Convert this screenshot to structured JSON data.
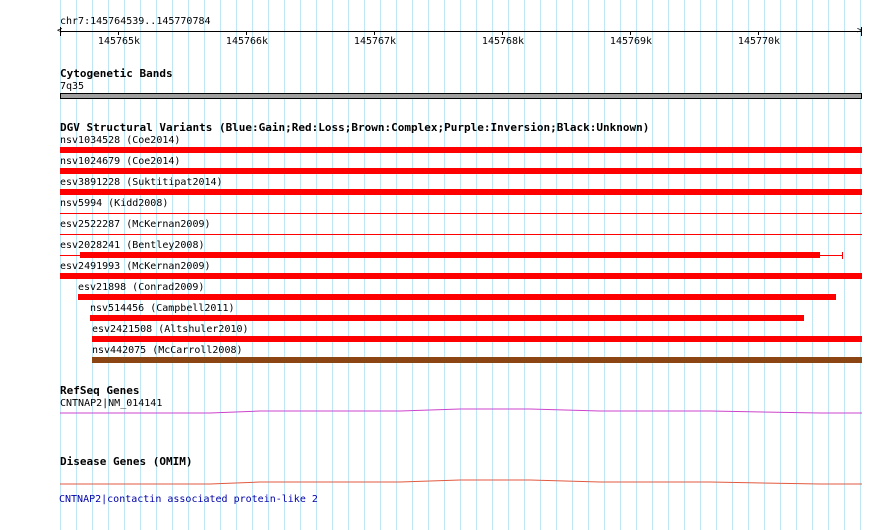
{
  "locus": "chr7:145764539..145770784",
  "ruler": {
    "ticks": [
      "145765k",
      "145766k",
      "145767k",
      "145768k",
      "145769k",
      "145770k"
    ]
  },
  "cytogenetic": {
    "title": "Cytogenetic Bands",
    "band": "7q35",
    "color": "#a0a0a0"
  },
  "dgv": {
    "title": "DGV Structural Variants (Blue:Gain;Red:Loss;Brown:Complex;Purple:Inversion;Black:Unknown)",
    "colors": {
      "loss": "#ff0000",
      "complex": "#8b4513"
    },
    "variants": [
      {
        "label": "nsv1034528 (Coe2014)",
        "type": "loss"
      },
      {
        "label": "nsv1024679 (Coe2014)",
        "type": "loss"
      },
      {
        "label": "esv3891228 (Suktitipat2014)",
        "type": "loss"
      },
      {
        "label": "nsv5994 (Kidd2008)",
        "type": "loss"
      },
      {
        "label": "esv2522287 (McKernan2009)",
        "type": "loss"
      },
      {
        "label": "esv2028241 (Bentley2008)",
        "type": "loss"
      },
      {
        "label": "esv2491993 (McKernan2009)",
        "type": "loss"
      },
      {
        "label": "esv21898 (Conrad2009)",
        "type": "loss"
      },
      {
        "label": "nsv514456 (Campbell2011)",
        "type": "loss"
      },
      {
        "label": "esv2421508 (Altshuler2010)",
        "type": "loss"
      },
      {
        "label": "nsv442075 (McCarroll2008)",
        "type": "complex"
      }
    ]
  },
  "refseq": {
    "title": "RefSeq Genes",
    "gene": "CNTNAP2|NM_014141",
    "color": "#cc44cc"
  },
  "disease": {
    "title": "Disease Genes (OMIM)",
    "gene": "CNTNAP2|contactin associated protein-like 2",
    "color": "#e05a40",
    "label_color": "#0000aa"
  }
}
